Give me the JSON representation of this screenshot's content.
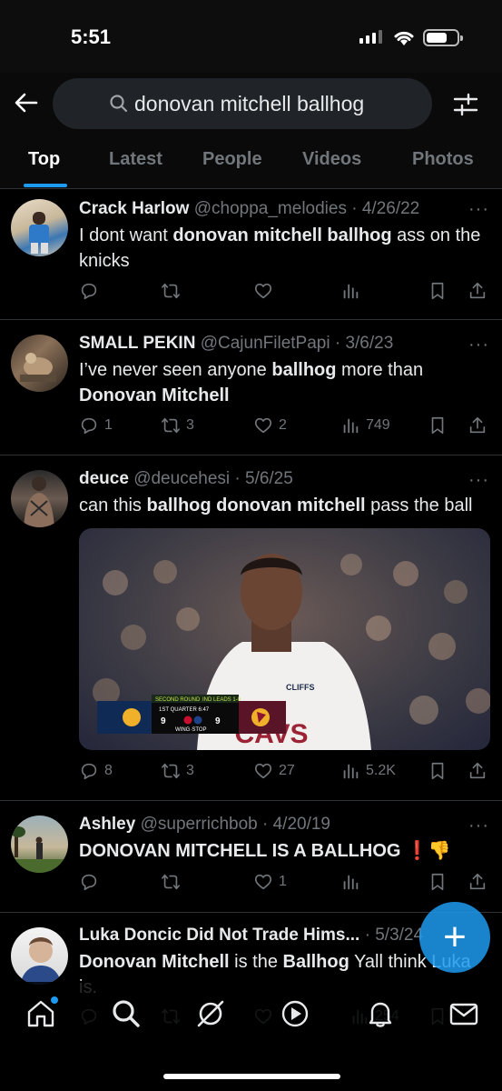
{
  "status": {
    "time": "5:51"
  },
  "search": {
    "query": "donovan mitchell ballhog"
  },
  "tabs": [
    "Top",
    "Latest",
    "People",
    "Videos",
    "Photos"
  ],
  "tweets": [
    {
      "name": "Crack Harlow",
      "meta": " @choppa_melodies · 4/26/22",
      "text_parts": [
        "I dont want ",
        "donovan mitchell ballhog",
        " ass on the knicks"
      ],
      "replies": "",
      "retweets": "",
      "likes": "",
      "views": ""
    },
    {
      "name": "SMALL PEKIN",
      "meta": " @CajunFiletPapi · 3/6/23",
      "text_parts": [
        "I’ve never seen anyone ",
        "ballhog",
        " more than ",
        "Donovan Mitchell"
      ],
      "replies": "1",
      "retweets": "3",
      "likes": "2",
      "views": "749"
    },
    {
      "name": "deuce",
      "meta": " @deucehesi · 5/6/25",
      "text_parts": [
        "can this ",
        "ballhog donovan mitchell",
        " pass the ball"
      ],
      "replies": "8",
      "retweets": "3",
      "likes": "27",
      "views": "5.2K",
      "media": {
        "round": "SECOND ROUND",
        "series": "IND LEADS 1-0",
        "quarter": "1ST QUARTER  6:47",
        "away_score": "9",
        "home_score": "9",
        "sponsor": "WING·STOP",
        "jersey": "CAVS",
        "jersey_sponsor": "CLIFFS"
      }
    },
    {
      "name": "Ashley",
      "meta": " @superrichbob · 4/20/19",
      "text_parts": [
        "DONOVAN MITCHELL",
        " IS A ",
        "BALLHOG",
        " ❗👎"
      ],
      "replies": "",
      "retweets": "",
      "likes": "1",
      "views": ""
    },
    {
      "name": "Luka Doncic Did Not Trade Hims...",
      "meta": " · 5/3/24",
      "text_parts": [
        "Donovan Mitchell",
        " is the ",
        "Ballhog",
        " Yall think Luka is."
      ],
      "replies": "",
      "retweets": "",
      "likes": "",
      "views": "254"
    }
  ],
  "fab": {
    "label": "+"
  },
  "colors": {
    "accent": "#1d9bf0",
    "muted": "#71767b",
    "text": "#e7e9ea",
    "border": "#2f3336"
  }
}
